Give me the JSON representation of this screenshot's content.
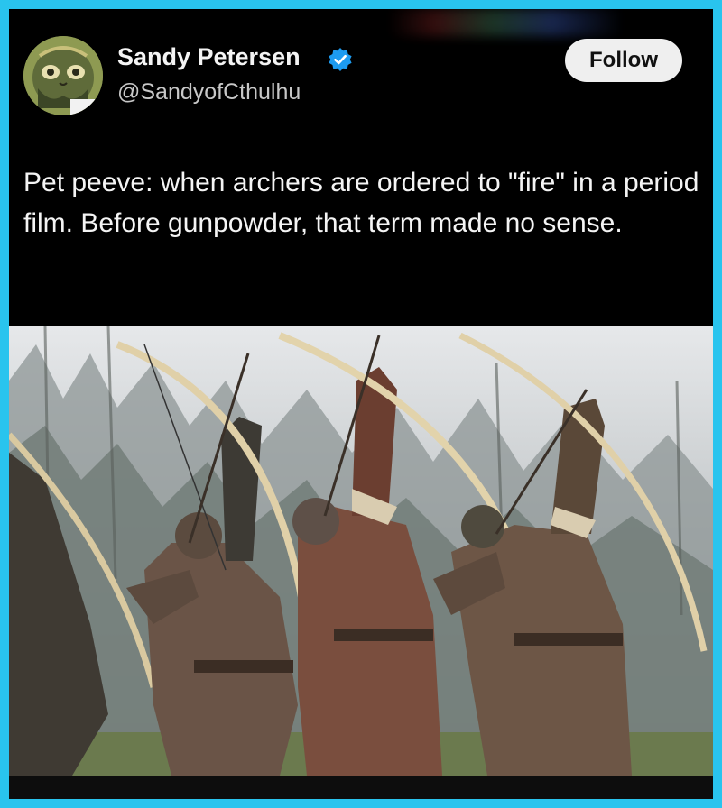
{
  "post": {
    "author_name": "Sandy Petersen",
    "author_handle": "@SandyofCthulhu",
    "verified": true,
    "follow_label": "Follow",
    "text": "Pet peeve: when archers are ordered to \"fire\" in a period film. Before gunpowder, that term made no sense."
  },
  "icons": {
    "verified": "verified-badge-icon",
    "avatar": "avatar-image"
  },
  "media": {
    "subject": "photo of medieval longbow archers drawing bows aimed upward"
  },
  "colors": {
    "border": "#29c4ee",
    "background": "#000000",
    "text": "#f4f4f4",
    "handle": "#c7c7c7",
    "verified": "#1d9bf0",
    "follow_bg": "#efefef"
  }
}
